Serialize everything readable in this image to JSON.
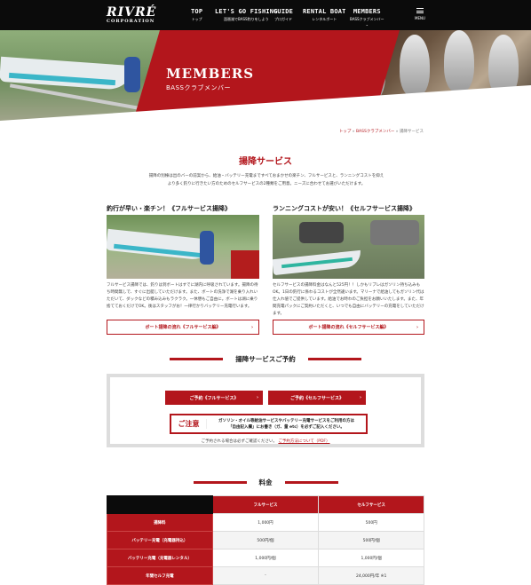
{
  "header": {
    "logo_main": "RIVRÉ",
    "logo_sub": "CORPORATION",
    "nav": [
      {
        "label": "TOP",
        "sub": "トップ"
      },
      {
        "label": "LET'S GO FISHING",
        "sub": "琵琶湖でBASS釣りをしよう"
      },
      {
        "label": "GUIDE",
        "sub": "プロガイド"
      },
      {
        "label": "RENTAL BOAT",
        "sub": "レンタルボート"
      },
      {
        "label": "MEMBERS",
        "sub": "BASSクラブメンバー",
        "caret": "⌄"
      }
    ],
    "menu_label": "MENU"
  },
  "hero": {
    "title": "MEMBERS",
    "subtitle": "BASSクラブメンバー"
  },
  "breadcrumb": {
    "home": "トップ",
    "sep": "»",
    "parent": "BASSクラブメンバー",
    "current": "揚降サービス"
  },
  "main": {
    "title": "揚降サービス",
    "intro_line1": "揚降の別棟は出のバーの前案から、給油・バッテリー充電まですべておまかせの楽チン、フルサービスと、ランニングコストを抑え",
    "intro_line2": "より多く釣りに行きたい方のためのセルフサービスの2種類をご用意。ニーズに合わせてお選びいただけます。",
    "full": {
      "title": "釣行が早い・楽チン！《フルサービス揚降》",
      "text": "フルサービス揚降では、釣りは到ボートはすでに湖内に呼吸されています。揚降の待ち時間無しで、すぐに出艇していただけます。また、ボートの洗浄で湖を乗り入れいただいて、ダックなどの積み込みもラクラク。一休憩もご自由に。ボートは湖に乗り捨てておくだけでOK。後はスタッフがお！一律行かりバッテリー充電行います。",
      "button": "ボート揚降の流れ《フルサービス編》",
      "arrow": "›"
    },
    "self": {
      "title": "ランニングコストが安い！《セルフサービス揚降》",
      "text": "セルフサービスの揚降料金はなんと525円！！しかもリプレはガソリン持ち込みもOK。1日の釣行に係わるコストが全然違います。マリーナで給油してもガソリン代は仕入れ値でご提供しています。給油でお時わのご負担をお願いいたします。また、年間充電パックにご契約いただくと、いつでも自由にバッテリーの充電をしていただけます。",
      "button": "ボート揚降の流れ《セルフサービス編》",
      "arrow": "›"
    }
  },
  "booking": {
    "title": "揚降サービスご予約",
    "btn_full": "ご予約《フルサービス》",
    "btn_self": "ご予約《セルフサービス》",
    "arrow": "›",
    "notice_label": "ご注意",
    "notice_line1": "ガソリン・オイル等給油サービスやバッテリー充電サービスをご利用の方は",
    "notice_line2": "「自由記入欄」にお書き（ガ、量 etc）を必ずご記入ください。",
    "note_prefix": "ご予約される場合は必ずご確認ください。",
    "note_link": "ご予約方法について（PDF）"
  },
  "price": {
    "title": "料金",
    "head_full": "フルサービス",
    "head_self": "セルフサービス",
    "rows": [
      {
        "label": "揚降料",
        "full": "1,000円",
        "self": "500円"
      },
      {
        "label": "バッテリー充電（充電器持込）",
        "full": "500円/個",
        "self": "500円/個"
      },
      {
        "label": "バッテリー充電（充電器レンタル）",
        "full": "1,000円/個",
        "self": "1,000円/個"
      },
      {
        "label": "年間セルフ充電",
        "full": "-",
        "self": "24,000円/年 ※1"
      }
    ]
  }
}
